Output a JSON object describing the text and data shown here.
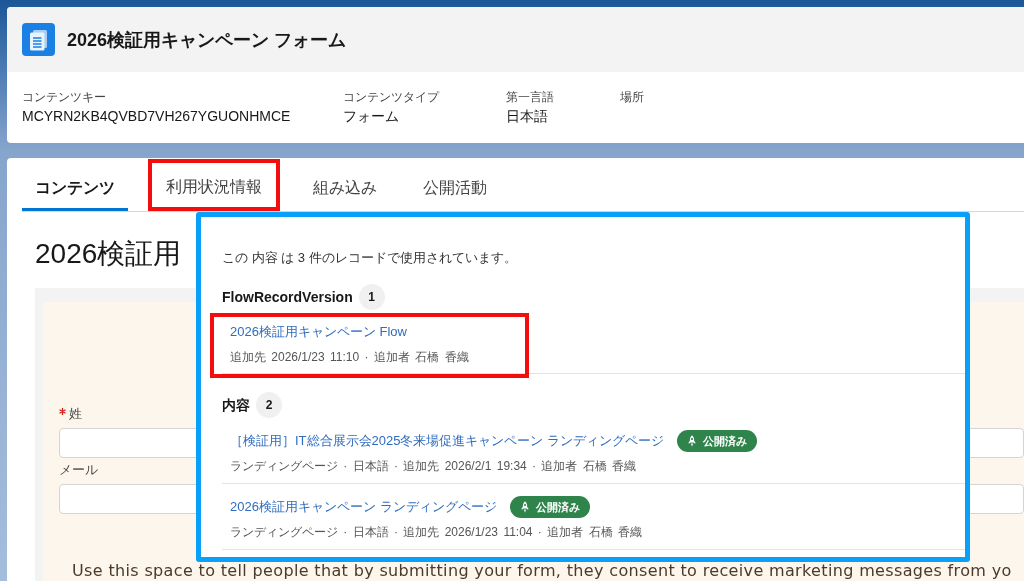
{
  "record_header": {
    "title": "2026検証用キャンペーン フォーム",
    "fields": [
      {
        "label": "コンテンツキー",
        "value": "MCYRN2KB4QVBD7VH267YGUONHMCE"
      },
      {
        "label": "コンテンツタイプ",
        "value": "フォーム"
      },
      {
        "label": "第一言語",
        "value": "日本語"
      },
      {
        "label": "場所"
      }
    ]
  },
  "tabs": [
    {
      "label": "コンテンツ",
      "selected": true,
      "highlighted": false
    },
    {
      "label": "利用状況情報",
      "selected": false,
      "highlighted": true
    },
    {
      "label": "組み込み",
      "selected": false,
      "highlighted": false
    },
    {
      "label": "公開活動",
      "selected": false,
      "highlighted": false
    }
  ],
  "content": {
    "heading": "2026検証用",
    "form": {
      "fields": [
        {
          "label": "姓",
          "required": true
        },
        {
          "label": "メール",
          "required": false
        }
      ],
      "consent_text": "Use this space to tell people that by submitting your form, they consent to receive marketing messages from yo"
    }
  },
  "usage_popover": {
    "summary": "この 内容 は 3 件のレコードで使用されています。",
    "groups": [
      {
        "name": "FlowRecordVersion",
        "count": "1",
        "items": [
          {
            "title": "2026検証用キャンペーン Flow",
            "meta": "追加先 2026/1/23 11:10 · 追加者 石橋 香織",
            "highlighted": true
          }
        ]
      },
      {
        "name": "内容",
        "count": "2",
        "items": [
          {
            "title": "［検証用］IT総合展示会2025冬来場促進キャンペーン ランディングページ",
            "status": "公開済み",
            "meta": "ランディングページ · 日本語 · 追加先 2026/2/1 19:34 · 追加者 石橋 香織",
            "highlighted": false
          },
          {
            "title": "2026検証用キャンペーン ランディングページ",
            "status": "公開済み",
            "meta": "ランディングページ · 日本語 · 追加先 2026/1/23 11:04 · 追加者 石橋 香織",
            "highlighted": false
          }
        ]
      }
    ]
  }
}
